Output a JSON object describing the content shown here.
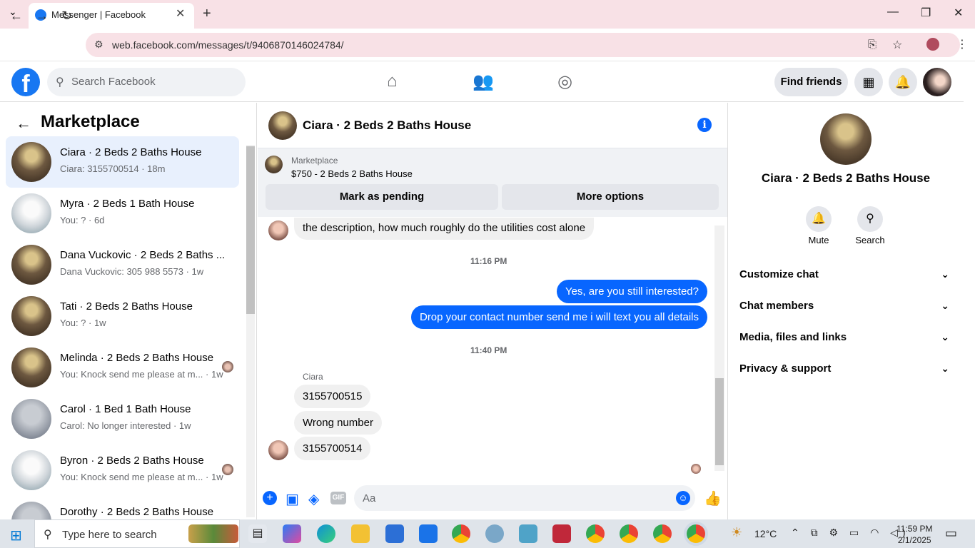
{
  "browser": {
    "tab_title": "Messenger | Facebook",
    "url": "web.facebook.com/messages/t/9406870146024784/"
  },
  "fb": {
    "search_placeholder": "Search Facebook",
    "find_friends": "Find friends"
  },
  "left": {
    "title": "Marketplace",
    "conversations": [
      {
        "name": "Ciara · 2 Beds 2 Baths House",
        "preview": "Ciara: 3155700514 · 18m",
        "thumb": "house",
        "selected": true
      },
      {
        "name": "Myra · 2 Beds 1 Bath House",
        "preview": "You: ? · 6d",
        "thumb": "bright"
      },
      {
        "name": "Dana Vuckovic · 2 Beds 2 Baths ...",
        "preview": "Dana Vuckovic: 305 988 5573 · 1w",
        "thumb": "house"
      },
      {
        "name": "Tati · 2 Beds 2 Baths House",
        "preview": "You: ? · 1w",
        "thumb": "house"
      },
      {
        "name": "Melinda · 2 Beds 2 Baths House",
        "preview": "You: Knock send me please at m... · 1w",
        "thumb": "house"
      },
      {
        "name": "Carol · 1 Bed 1 Bath House",
        "preview": "Carol: No longer interested · 1w",
        "thumb": "grey"
      },
      {
        "name": "Byron · 2 Beds 2 Baths House",
        "preview": "You: Knock send me please at m... · 1w",
        "thumb": "bright"
      },
      {
        "name": "Dorothy · 2 Beds 2 Baths House",
        "preview": "",
        "thumb": "grey"
      }
    ]
  },
  "chat": {
    "title": "Ciara · 2 Beds 2 Baths House",
    "listing_source": "Marketplace",
    "listing_price": "$750 - 2 Beds 2 Baths House",
    "mark_pending": "Mark as pending",
    "more_options": "More options",
    "partial_message": "the description, how much roughly do the utilities cost alone",
    "time1": "11:16 PM",
    "out1": "Yes, are you still interested?",
    "out2": "Drop your contact number send me i will text you all details",
    "time2": "11:40 PM",
    "sender": "Ciara",
    "in1": "3155700515",
    "in2": "Wrong number",
    "in3": "3155700514",
    "input_placeholder": "Aa"
  },
  "right": {
    "name": "Ciara · 2 Beds 2 Baths House",
    "mute": "Mute",
    "search": "Search",
    "sections": [
      "Customize chat",
      "Chat members",
      "Media, files and links",
      "Privacy & support"
    ]
  },
  "taskbar": {
    "search_placeholder": "Type here to search",
    "weather": "12°C",
    "time": "11:59 PM",
    "date": "2/1/2025"
  },
  "colors": {
    "accent": "#0866ff",
    "fb_blue": "#1877f2",
    "tab_bg": "#f8e1e6"
  }
}
